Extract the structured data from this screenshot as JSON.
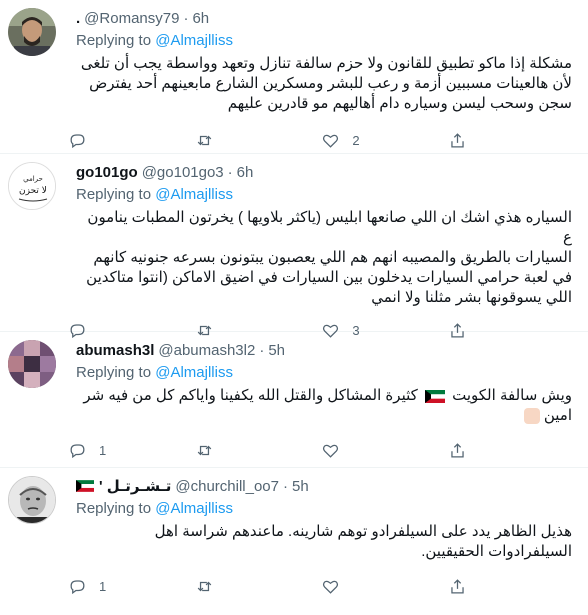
{
  "tweets": [
    {
      "name": ".",
      "handle": "@Romansy79",
      "time": "6h",
      "replying_prefix": "Replying to ",
      "replying_to": "@Almajlliss",
      "text": "مشكلة إذا ماكو تطبيق للقانون ولا حزم سالفة تنازل وتعهد وواسطة يجب أن تلغى\nلأن هالعينات مسببين أزمة و رعب للبشر ومسكرين الشارع مابعينهم أحد يفترض\nسجن وسحب ليسن وسياره دام أهاليهم مو قادرين عليهم",
      "replies": "",
      "retweets": "",
      "likes": "2"
    },
    {
      "name": "go101go",
      "handle": "@go101go3",
      "time": "6h",
      "replying_prefix": "Replying to ",
      "replying_to": "@Almajlliss",
      "text": "السياره هذي اشك ان اللي صانعها ابليس (ياكثر بلاويها ) يخرتون المطبات ينامون ع\nالسيارات بالطريق والمصيبه انهم هم اللي يعصبون يبتونون بسرعه جنونيه  كانهم\nفي لعبة حرامي السيارات يدخلون بين السيارات في اضيق الاماكن (انتوا متاكدين\nاللي يسوقونها بشر مثلنا ولا انمي",
      "replies": "",
      "retweets": "",
      "likes": "3"
    },
    {
      "name": "abumash3l",
      "handle": "@abumash3l2",
      "time": "5h",
      "replying_prefix": "Replying to ",
      "replying_to": "@Almajlliss",
      "text_before_flag": "ويش سالفة الكويت",
      "text_after_flag": "كثيرة المشاكل والقتل الله يكفينا واياكم كل من فيه شر",
      "text_line2": "امين",
      "replies": "1",
      "retweets": "",
      "likes": ""
    },
    {
      "name": "' تـشـرتـل",
      "handle": "@churchill_oo7",
      "time": "5h",
      "replying_prefix": "Replying to ",
      "replying_to": "@Almajlliss",
      "text": "هذيل الظاهر يدد على السيلفرادو توهم شارينه. ماعندهم شراسة اهل\nالسيلفرادوات الحقيقيين.",
      "replies": "1",
      "retweets": "",
      "likes": ""
    }
  ],
  "icons": [
    "reply-icon",
    "retweet-icon",
    "like-icon",
    "share-icon"
  ],
  "colors": {
    "link": "#1d9bf0",
    "secondary": "#536471",
    "border": "#eff3f4"
  }
}
